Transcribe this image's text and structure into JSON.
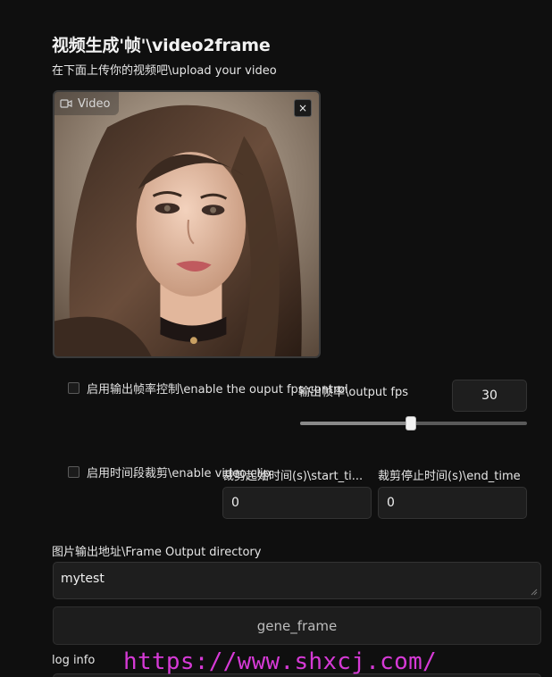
{
  "header": {
    "title": "视频生成'帧'\\video2frame",
    "subtitle": "在下面上传你的视频吧\\upload your video"
  },
  "video": {
    "label": "Video",
    "close_symbol": "×"
  },
  "fps_control": {
    "checkbox_label": "启用输出帧率控制\\enable the ouput fps control",
    "fps_label": "输出帧率\\output fps",
    "fps_value": "30",
    "slider_fraction": 0.49
  },
  "time_clip": {
    "checkbox_label": "启用时间段裁剪\\enable video clip",
    "start_label": "裁剪起始时间(s)\\start_ti...",
    "start_value": "0",
    "end_label": "裁剪停止时间(s)\\end_time",
    "end_value": "0"
  },
  "output": {
    "dir_label": "图片输出地址\\Frame Output directory",
    "dir_value": "mytest"
  },
  "actions": {
    "gene_label": "gene_frame"
  },
  "log": {
    "label": "log info"
  },
  "watermark": {
    "text": "https://www.shxcj.com/"
  }
}
